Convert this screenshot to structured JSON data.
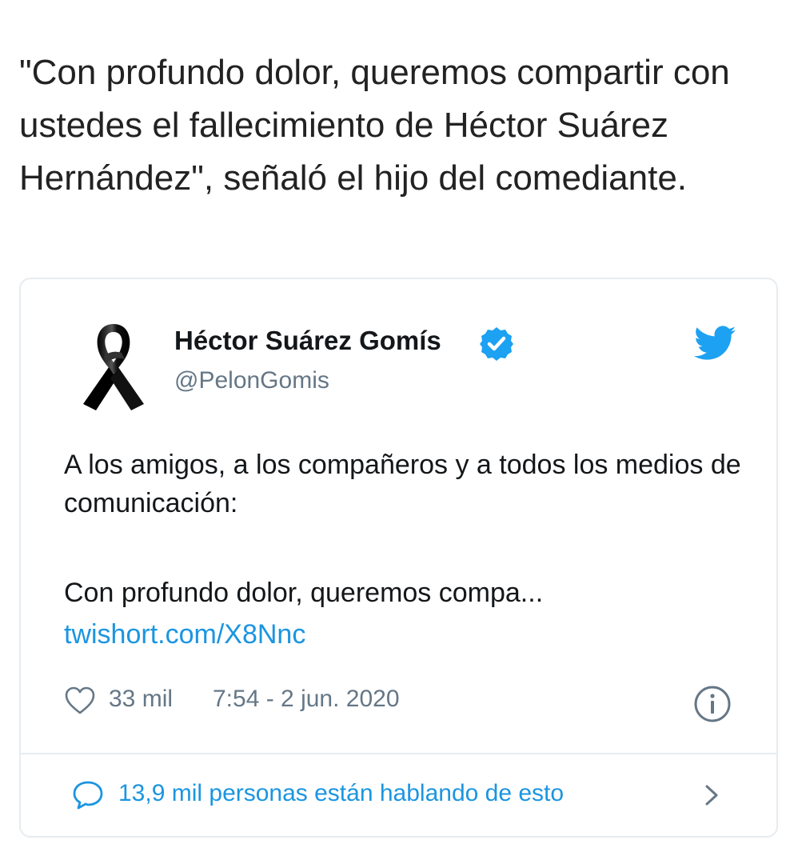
{
  "article": {
    "paragraph": "\"Con profundo dolor, queremos compartir con ustedes el fallecimiento de Héctor Suárez Hernández\", señaló el hijo del comediante."
  },
  "tweet": {
    "author_name": "Héctor Suárez Gomís",
    "author_handle": "@PelonGomis",
    "avatar_icon": "black-mourning-ribbon-icon",
    "verified_icon": "verified-badge-icon",
    "platform_icon": "twitter-bird-icon",
    "body_line_1": "A los amigos, a los compañeros y a todos los medios de comunicación:",
    "body_line_2": "Con profundo dolor, queremos compa...",
    "link": "twishort.com/X8Nnc",
    "likes": "33 mil",
    "timestamp": "7:54 - 2 jun. 2020",
    "conversation": "13,9 mil personas están hablando de esto"
  },
  "colors": {
    "link_blue": "#1b95e0",
    "verified_blue": "#1da1f2",
    "muted_gray": "#657786",
    "border": "#e6ecf0",
    "text_dark": "#14171a"
  }
}
